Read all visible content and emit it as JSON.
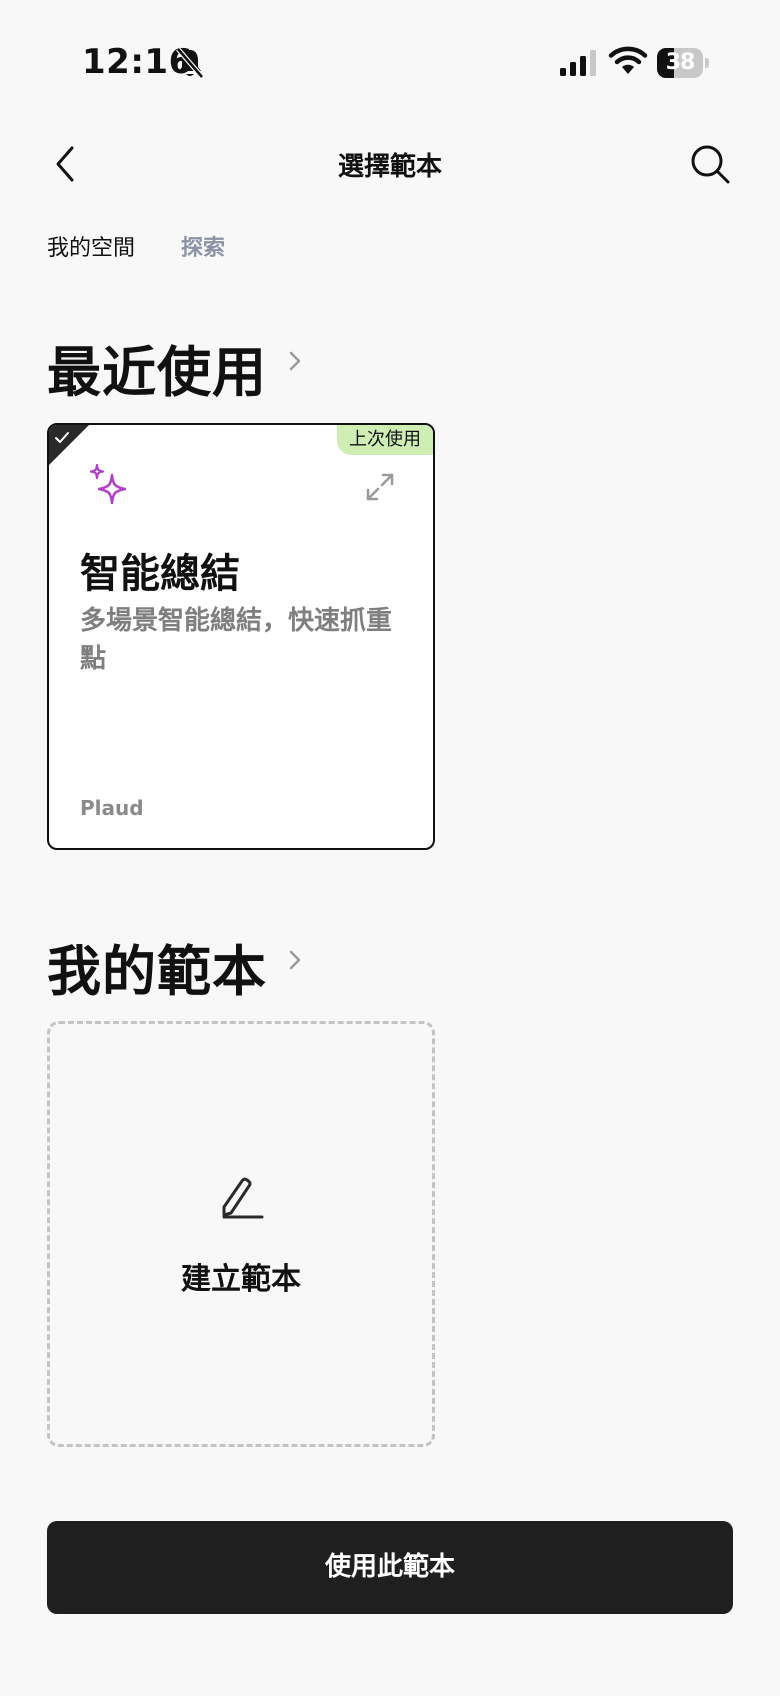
{
  "status_bar": {
    "time": "12:16",
    "battery_level": "38",
    "battery_fraction": 0.38
  },
  "nav": {
    "title": "選擇範本",
    "back_icon": "chevron-left-icon",
    "search_icon": "search-icon"
  },
  "tabs": [
    {
      "label": "我的空間",
      "active": true
    },
    {
      "label": "探索",
      "active": false
    }
  ],
  "recent_section": {
    "title": "最近使用",
    "card": {
      "badge": "上次使用",
      "icon": "sparkle-icon",
      "title": "智能總結",
      "description": "多場景智能總結，快速抓重點",
      "author": "Plaud",
      "selected": true
    }
  },
  "my_templates_section": {
    "title": "我的範本",
    "create_label": "建立範本"
  },
  "footer": {
    "use_button": "使用此範本"
  },
  "colors": {
    "accent_purple": "#b23fc9",
    "badge_green": "#cfeeb4",
    "button_dark": "#1f1f1f",
    "inactive_tab": "#8b93a7",
    "background": "#f8f8f8"
  }
}
